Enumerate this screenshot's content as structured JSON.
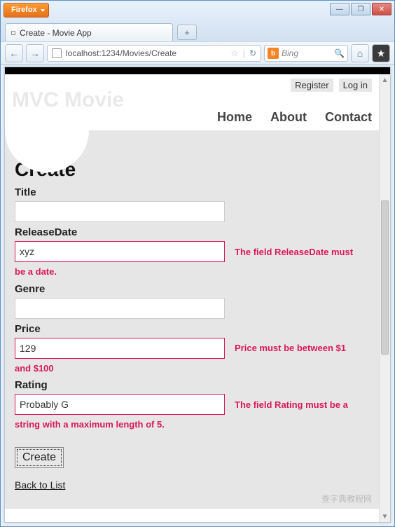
{
  "window": {
    "app_button": "Firefox",
    "tab_title": "Create - Movie App",
    "new_tab_glyph": "+",
    "min_glyph": "—",
    "max_glyph": "❐",
    "close_glyph": "✕"
  },
  "nav": {
    "back_glyph": "←",
    "fwd_glyph": "→",
    "url": "localhost:1234/Movies/Create",
    "star_glyph": "☆",
    "reload_glyph": "↻",
    "search_engine_icon": "b",
    "search_placeholder": "Bing",
    "search_go_glyph": "🔍",
    "home_glyph": "⌂",
    "bookmarks_glyph": "★"
  },
  "header": {
    "register": "Register",
    "login": "Log in",
    "brand": "MVC Movie",
    "menu": {
      "home": "Home",
      "about": "About",
      "contact": "Contact"
    }
  },
  "form": {
    "heading": "Create",
    "title": {
      "label": "Title",
      "value": ""
    },
    "releaseDate": {
      "label": "ReleaseDate",
      "value": "xyz",
      "error_inline": "The field ReleaseDate must",
      "error_wrap": "be a date."
    },
    "genre": {
      "label": "Genre",
      "value": ""
    },
    "price": {
      "label": "Price",
      "value": "129",
      "error_inline": "Price must be between $1",
      "error_wrap": "and $100"
    },
    "rating": {
      "label": "Rating",
      "value": "Probably G",
      "error_inline": "The field Rating must be a",
      "error_wrap": "string with a maximum length of 5."
    },
    "submit": "Create",
    "back": "Back to List"
  },
  "watermark": "查字典教程网"
}
